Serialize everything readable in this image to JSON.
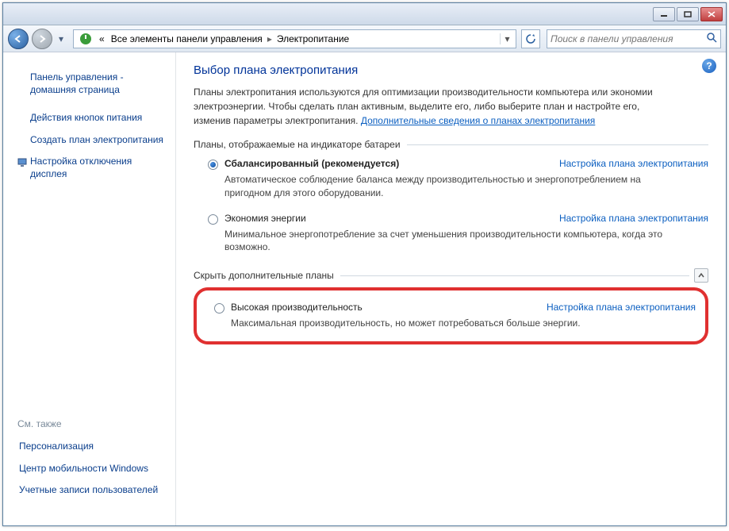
{
  "breadcrumb": {
    "item1": "Все элементы панели управления",
    "item2": "Электропитание"
  },
  "search": {
    "placeholder": "Поиск в панели управления"
  },
  "sidebar": {
    "home": "Панель управления - домашняя страница",
    "link1": "Действия кнопок питания",
    "link2": "Создать план электропитания",
    "link3": "Настройка отключения дисплея",
    "see_also": "См. также",
    "foot1": "Персонализация",
    "foot2": "Центр мобильности Windows",
    "foot3": "Учетные записи пользователей"
  },
  "main": {
    "title": "Выбор плана электропитания",
    "desc1": "Планы электропитания используются для оптимизации производительности компьютера или экономии электроэнергии. Чтобы сделать план активным, выделите его, либо выберите план и настройте его, изменив параметры электропитания. ",
    "desc_link": "Дополнительные сведения о планах электропитания",
    "group_battery": "Планы, отображаемые на индикаторе батареи",
    "group_extra": "Скрыть дополнительные планы",
    "plan1": {
      "name": "Сбалансированный (рекомендуется)",
      "desc": "Автоматическое соблюдение баланса между производительностью и энергопотреблением на пригодном для этого оборудовании."
    },
    "plan2": {
      "name": "Экономия энергии",
      "desc": "Минимальное энергопотребление за счет уменьшения производительности компьютера, когда это возможно."
    },
    "plan3": {
      "name": "Высокая производительность",
      "desc": "Максимальная производительность, но может потребоваться больше энергии."
    },
    "settings_label": "Настройка плана электропитания"
  }
}
